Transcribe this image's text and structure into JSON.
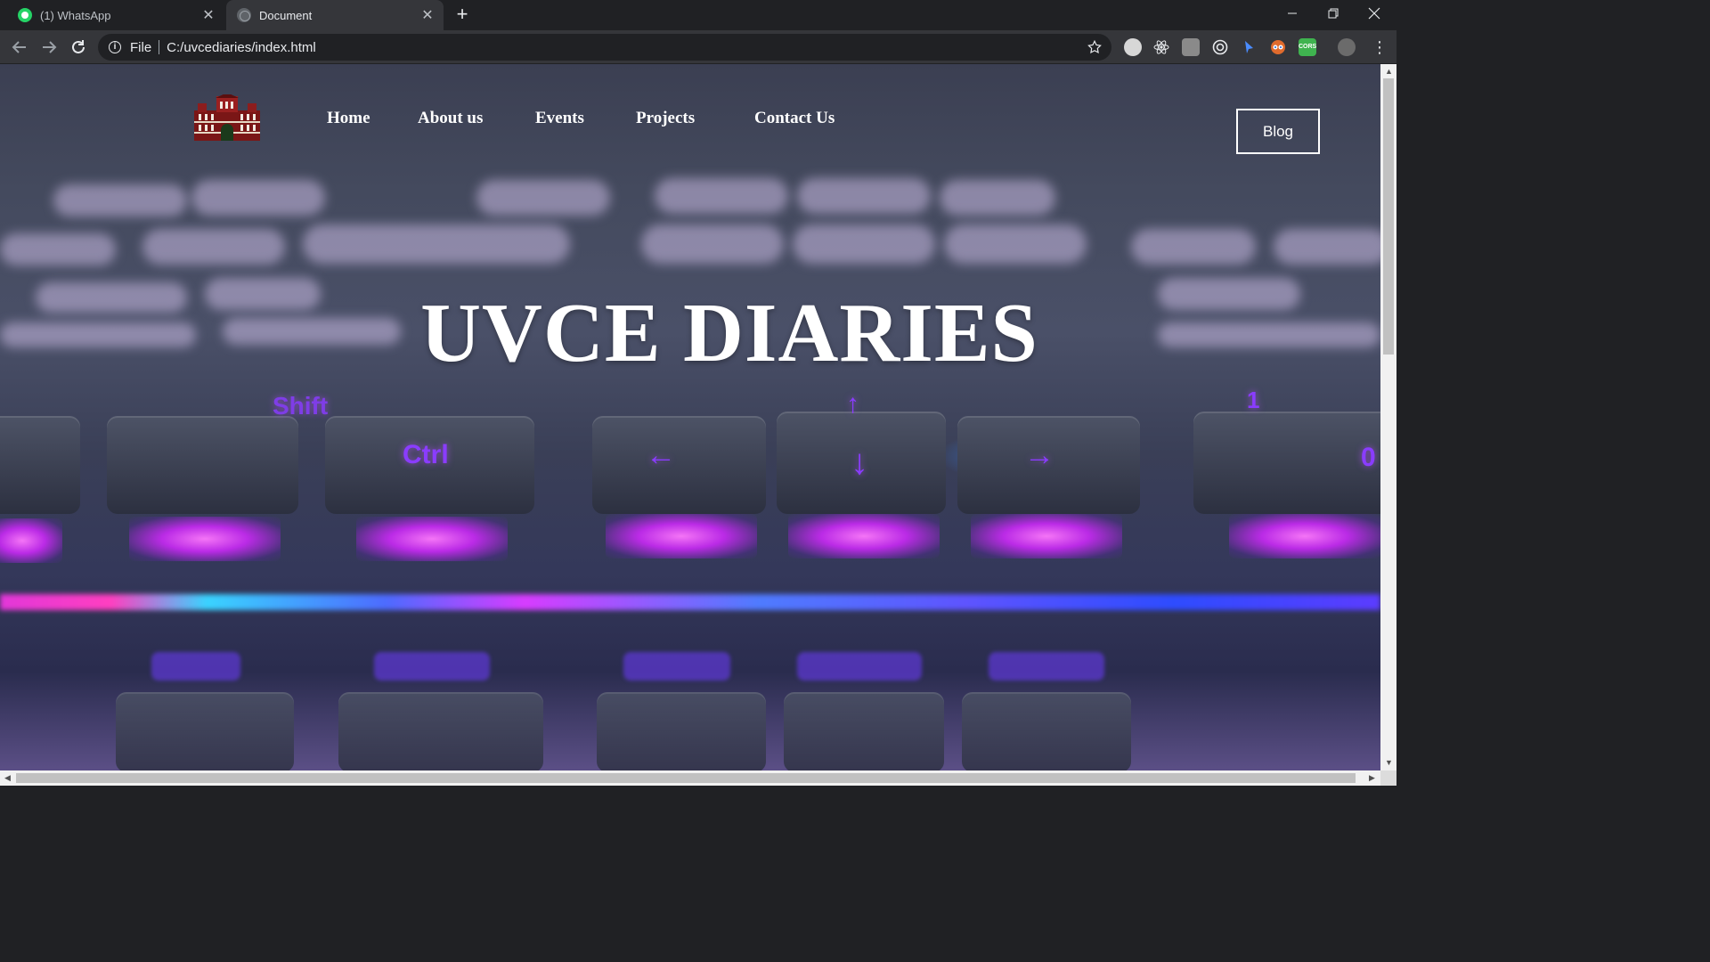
{
  "browser": {
    "tabs": [
      {
        "label": "(1) WhatsApp",
        "favicon": "whatsapp-icon",
        "active": false
      },
      {
        "label": "Document",
        "favicon": "globe-icon",
        "active": true
      }
    ],
    "address": {
      "scheme": "File",
      "url": "C:/uvcediaries/index.html"
    }
  },
  "site": {
    "logo_alt": "uvce-building-logo",
    "nav": [
      "Home",
      "About us",
      "Events",
      "Projects",
      "Contact Us"
    ],
    "blog_button": "Blog",
    "hero_title": "UVCE DIARIES"
  },
  "hero_keys": [
    "Shift",
    "Ctrl",
    "←",
    "↓",
    "→",
    "↑",
    "1",
    "0"
  ],
  "colors": {
    "chrome_dark": "#202124",
    "chrome_toolbar": "#35363a",
    "accent_purple": "#8a3cff",
    "neon_pink": "#e237d9",
    "text_white": "#ffffff"
  }
}
